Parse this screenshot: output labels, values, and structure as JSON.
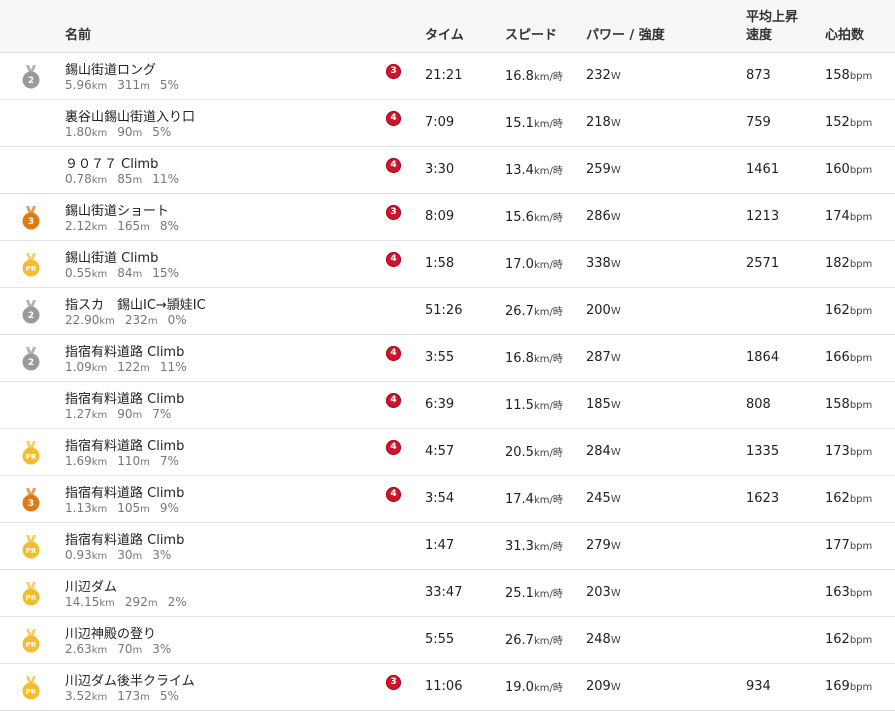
{
  "header": {
    "name": "名前",
    "time": "タイム",
    "speed": "スピード",
    "power": "パワー / 強度",
    "vam_line1": "平均上昇",
    "vam_line2": "速度",
    "hr": "心拍数"
  },
  "medal_colors": {
    "silver": "#9a9a9a",
    "bronze": "#e07b14",
    "pr": "#f4bd2c",
    "category": "#d0142a"
  },
  "rows": [
    {
      "medal": "2",
      "medal_type": "silver",
      "name": "錫山街道ロング",
      "distance": "5.96",
      "distance_unit": "km",
      "elevation": "311",
      "elevation_unit": "m",
      "grade": "5%",
      "category": "3",
      "time": "21:21",
      "speed": "16.8",
      "speed_unit": "km/時",
      "power": "232",
      "power_unit": "W",
      "vam": "873",
      "hr": "158",
      "hr_unit": "bpm"
    },
    {
      "medal": "",
      "medal_type": "",
      "name": "裏谷山錫山街道入り口",
      "distance": "1.80",
      "distance_unit": "km",
      "elevation": "90",
      "elevation_unit": "m",
      "grade": "5%",
      "category": "4",
      "time": "7:09",
      "speed": "15.1",
      "speed_unit": "km/時",
      "power": "218",
      "power_unit": "W",
      "vam": "759",
      "hr": "152",
      "hr_unit": "bpm"
    },
    {
      "medal": "",
      "medal_type": "",
      "name": "９０７７ Climb",
      "distance": "0.78",
      "distance_unit": "km",
      "elevation": "85",
      "elevation_unit": "m",
      "grade": "11%",
      "category": "4",
      "time": "3:30",
      "speed": "13.4",
      "speed_unit": "km/時",
      "power": "259",
      "power_unit": "W",
      "vam": "1461",
      "hr": "160",
      "hr_unit": "bpm"
    },
    {
      "medal": "3",
      "medal_type": "bronze",
      "name": "錫山街道ショート",
      "distance": "2.12",
      "distance_unit": "km",
      "elevation": "165",
      "elevation_unit": "m",
      "grade": "8%",
      "category": "3",
      "time": "8:09",
      "speed": "15.6",
      "speed_unit": "km/時",
      "power": "286",
      "power_unit": "W",
      "vam": "1213",
      "hr": "174",
      "hr_unit": "bpm"
    },
    {
      "medal": "PR",
      "medal_type": "pr",
      "name": "錫山街道 Climb",
      "distance": "0.55",
      "distance_unit": "km",
      "elevation": "84",
      "elevation_unit": "m",
      "grade": "15%",
      "category": "4",
      "time": "1:58",
      "speed": "17.0",
      "speed_unit": "km/時",
      "power": "338",
      "power_unit": "W",
      "vam": "2571",
      "hr": "182",
      "hr_unit": "bpm"
    },
    {
      "medal": "2",
      "medal_type": "silver",
      "name": "指スカ　錫山IC→頴娃IC",
      "distance": "22.90",
      "distance_unit": "km",
      "elevation": "232",
      "elevation_unit": "m",
      "grade": "0%",
      "category": "",
      "time": "51:26",
      "speed": "26.7",
      "speed_unit": "km/時",
      "power": "200",
      "power_unit": "W",
      "vam": "",
      "hr": "162",
      "hr_unit": "bpm"
    },
    {
      "medal": "2",
      "medal_type": "silver",
      "name": "指宿有料道路 Climb",
      "distance": "1.09",
      "distance_unit": "km",
      "elevation": "122",
      "elevation_unit": "m",
      "grade": "11%",
      "category": "4",
      "time": "3:55",
      "speed": "16.8",
      "speed_unit": "km/時",
      "power": "287",
      "power_unit": "W",
      "vam": "1864",
      "hr": "166",
      "hr_unit": "bpm"
    },
    {
      "medal": "",
      "medal_type": "",
      "name": "指宿有料道路 Climb",
      "distance": "1.27",
      "distance_unit": "km",
      "elevation": "90",
      "elevation_unit": "m",
      "grade": "7%",
      "category": "4",
      "time": "6:39",
      "speed": "11.5",
      "speed_unit": "km/時",
      "power": "185",
      "power_unit": "W",
      "vam": "808",
      "hr": "158",
      "hr_unit": "bpm"
    },
    {
      "medal": "PR",
      "medal_type": "pr",
      "name": "指宿有料道路 Climb",
      "distance": "1.69",
      "distance_unit": "km",
      "elevation": "110",
      "elevation_unit": "m",
      "grade": "7%",
      "category": "4",
      "time": "4:57",
      "speed": "20.5",
      "speed_unit": "km/時",
      "power": "284",
      "power_unit": "W",
      "vam": "1335",
      "hr": "173",
      "hr_unit": "bpm"
    },
    {
      "medal": "3",
      "medal_type": "bronze",
      "name": "指宿有料道路 Climb",
      "distance": "1.13",
      "distance_unit": "km",
      "elevation": "105",
      "elevation_unit": "m",
      "grade": "9%",
      "category": "4",
      "time": "3:54",
      "speed": "17.4",
      "speed_unit": "km/時",
      "power": "245",
      "power_unit": "W",
      "vam": "1623",
      "hr": "162",
      "hr_unit": "bpm"
    },
    {
      "medal": "PR",
      "medal_type": "pr",
      "name": "指宿有料道路 Climb",
      "distance": "0.93",
      "distance_unit": "km",
      "elevation": "30",
      "elevation_unit": "m",
      "grade": "3%",
      "category": "",
      "time": "1:47",
      "speed": "31.3",
      "speed_unit": "km/時",
      "power": "279",
      "power_unit": "W",
      "vam": "",
      "hr": "177",
      "hr_unit": "bpm"
    },
    {
      "medal": "PR",
      "medal_type": "pr",
      "name": "川辺ダム",
      "distance": "14.15",
      "distance_unit": "km",
      "elevation": "292",
      "elevation_unit": "m",
      "grade": "2%",
      "category": "",
      "time": "33:47",
      "speed": "25.1",
      "speed_unit": "km/時",
      "power": "203",
      "power_unit": "W",
      "vam": "",
      "hr": "163",
      "hr_unit": "bpm"
    },
    {
      "medal": "PR",
      "medal_type": "pr",
      "name": "川辺神殿の登り",
      "distance": "2.63",
      "distance_unit": "km",
      "elevation": "70",
      "elevation_unit": "m",
      "grade": "3%",
      "category": "",
      "time": "5:55",
      "speed": "26.7",
      "speed_unit": "km/時",
      "power": "248",
      "power_unit": "W",
      "vam": "",
      "hr": "162",
      "hr_unit": "bpm"
    },
    {
      "medal": "PR",
      "medal_type": "pr",
      "name": "川辺ダム後半クライム",
      "distance": "3.52",
      "distance_unit": "km",
      "elevation": "173",
      "elevation_unit": "m",
      "grade": "5%",
      "category": "3",
      "time": "11:06",
      "speed": "19.0",
      "speed_unit": "km/時",
      "power": "209",
      "power_unit": "W",
      "vam": "934",
      "hr": "169",
      "hr_unit": "bpm"
    }
  ]
}
